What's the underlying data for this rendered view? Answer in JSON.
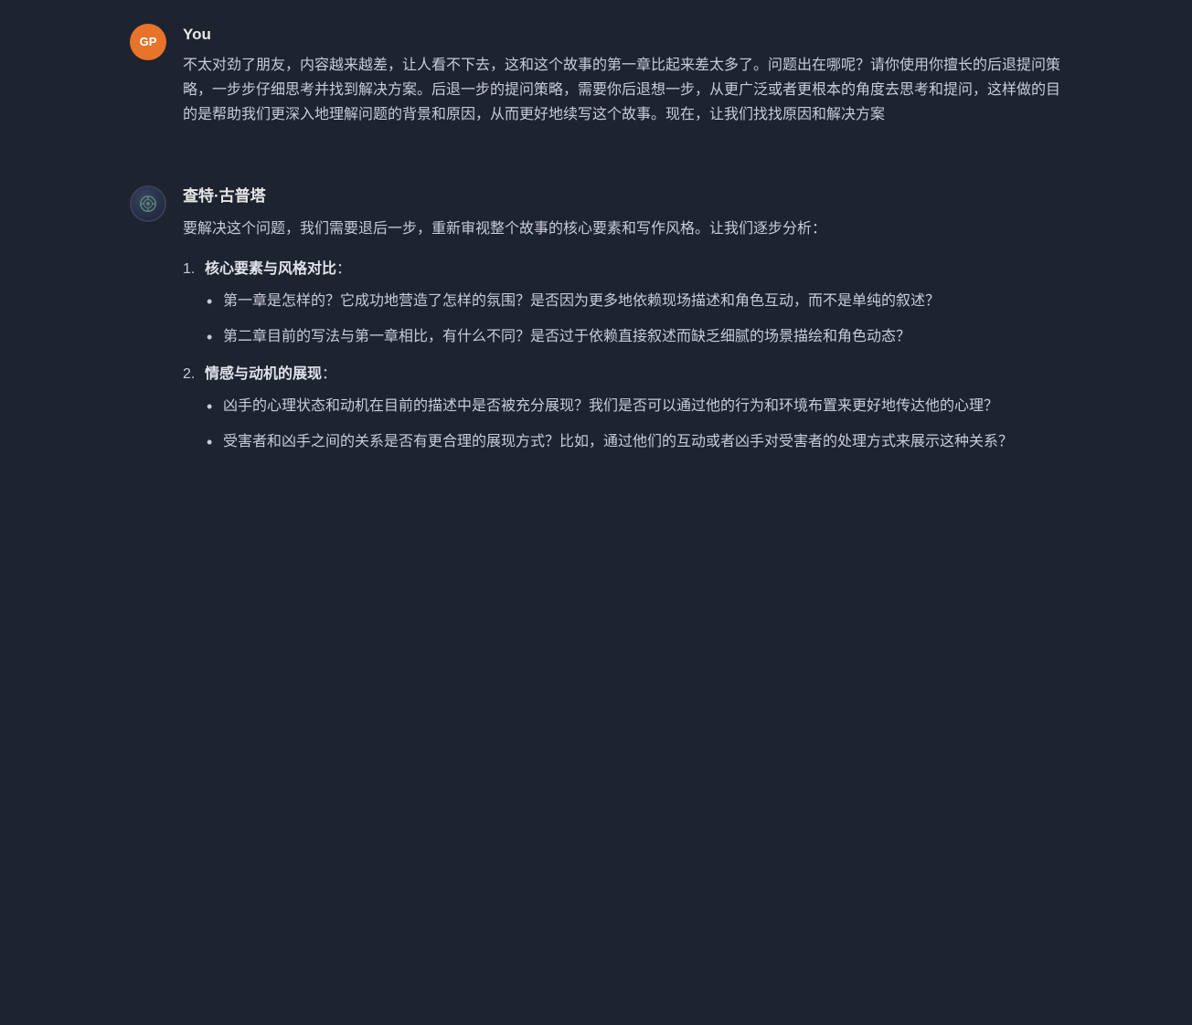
{
  "user": {
    "name": "You",
    "avatar_initials": "GP",
    "message": "不太对劲了朋友，内容越来越差，让人看不下去，这和这个故事的第一章比起来差太多了。问题出在哪呢？请你使用你擅长的后退提问策略，一步步仔细思考并找到解决方案。后退一步的提问策略，需要你后退想一步，从更广泛或者更根本的角度去思考和提问，这样做的目的是帮助我们更深入地理解问题的背景和原因，从而更好地续写这个故事。现在，让我们找找原因和解决方案"
  },
  "ai": {
    "name": "查特·古普塔",
    "avatar_symbol": "⚙",
    "intro": "要解决这个问题，我们需要退后一步，重新审视整个故事的核心要素和写作风格。让我们逐步分析：",
    "sections": [
      {
        "number": "1.",
        "title_bold": "核心要素与风格对比",
        "title_suffix": "：",
        "bullets": [
          "第一章是怎样的？它成功地营造了怎样的氛围？是否因为更多地依赖现场描述和角色互动，而不是单纯的叙述？",
          "第二章目前的写法与第一章相比，有什么不同？是否过于依赖直接叙述而缺乏细腻的场景描绘和角色动态？"
        ]
      },
      {
        "number": "2.",
        "title_bold": "情感与动机的展现",
        "title_suffix": "：",
        "bullets": [
          "凶手的心理状态和动机在目前的描述中是否被充分展现？我们是否可以通过他的行为和环境布置来更好地传达他的心理？",
          "受害者和凶手之间的关系是否有更合理的展现方式？比如，通过他们的互动或者凶手对受害者的处理方式来展示这种关系？"
        ]
      }
    ]
  }
}
